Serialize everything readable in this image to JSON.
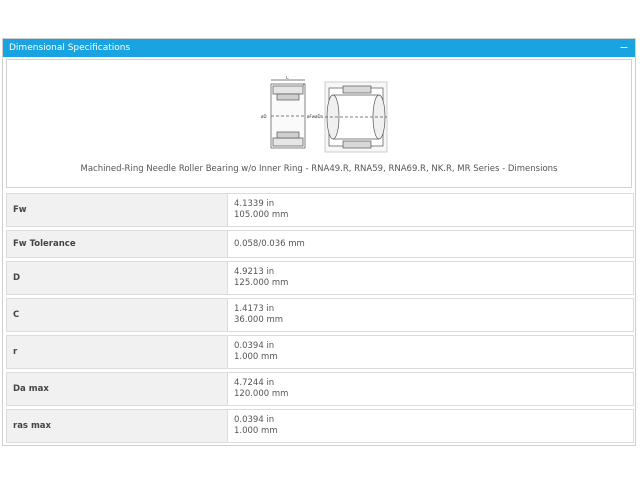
{
  "panel": {
    "title": "Dimensional Specifications",
    "collapse_glyph": "−"
  },
  "figure": {
    "caption": "Machined-Ring Needle Roller Bearing w/o Inner Ring - RNA49.R, RNA59, RNA69.R, NK.R, MR Series - Dimensions",
    "labels": {
      "c": "C",
      "r": "r",
      "d": "øD",
      "fw": "øFw",
      "da": "øDa"
    }
  },
  "specs": [
    {
      "label": "Fw",
      "lines": [
        "4.1339 in",
        "105.000 mm"
      ]
    },
    {
      "label": "Fw Tolerance",
      "lines": [
        "0.058/0.036 mm"
      ]
    },
    {
      "label": "D",
      "lines": [
        "4.9213 in",
        "125.000 mm"
      ]
    },
    {
      "label": "C",
      "lines": [
        "1.4173 in",
        "36.000 mm"
      ]
    },
    {
      "label": "r",
      "lines": [
        "0.0394 in",
        "1.000 mm"
      ]
    },
    {
      "label": "Da max",
      "lines": [
        "4.7244 in",
        "120.000 mm"
      ]
    },
    {
      "label": "ras max",
      "lines": [
        "0.0394 in",
        "1.000 mm"
      ]
    }
  ]
}
